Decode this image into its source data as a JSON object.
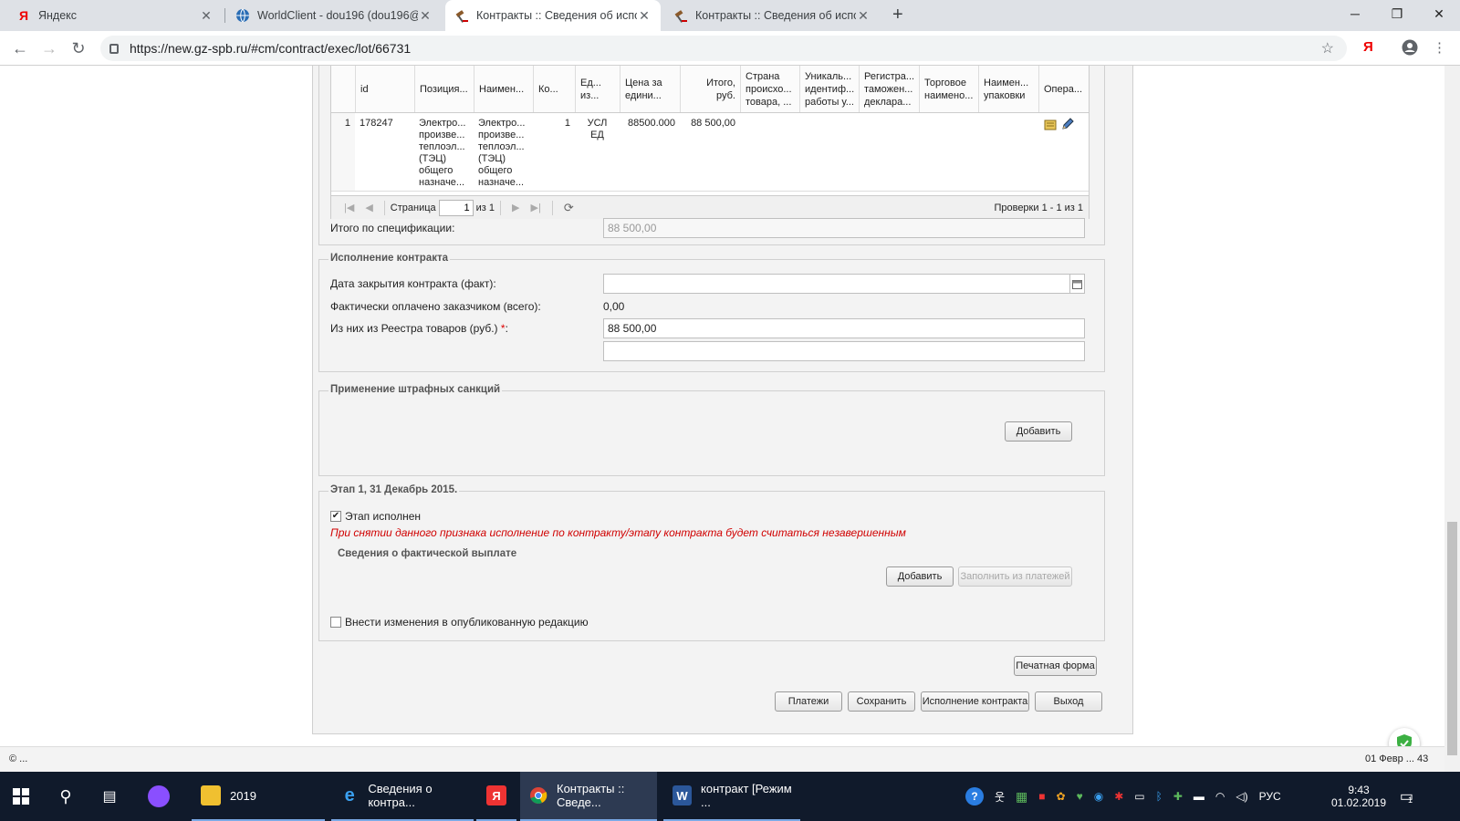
{
  "browser": {
    "tabs": [
      {
        "title": "Яндекс",
        "favicon": "Я"
      },
      {
        "title": "WorldClient - dou196 (dou196@",
        "favicon": "globe"
      },
      {
        "title": "Контракты :: Сведения об испол",
        "favicon": "gavel",
        "active": true
      },
      {
        "title": "Контракты :: Сведения об испол",
        "favicon": "gavel"
      }
    ],
    "url": "https://new.gz-spb.ru/#cm/contract/exec/lot/66731",
    "extension_label": "Я"
  },
  "grid": {
    "columns": [
      "",
      "id",
      "Позиция...",
      "Наимен...",
      "Ко...",
      "Ед... из...",
      "Цена за едини...",
      "Итого, руб.",
      "Страна происхо... товара, ...",
      "Уникаль... идентиф... работы у...",
      "Регистра... таможен... деклара...",
      "Торговое наимено...",
      "Наимен... упаковки",
      "Опера..."
    ],
    "row": {
      "num": "1",
      "id": "178247",
      "position": "Электро... произве... теплоэл... (ТЭЦ) общего назначе...",
      "name": "Электро... произве... теплоэл... (ТЭЦ) общего назначе...",
      "qty": "1",
      "unit": "УСЛ ЕД",
      "price": "88500.000",
      "total": "88 500,00"
    },
    "pager": {
      "page_label": "Страница",
      "page_value": "1",
      "of_label": "из 1",
      "summary": "Проверки 1 - 1 из 1"
    }
  },
  "spec_total": {
    "label": "Итого по спецификации:",
    "value": "88 500,00"
  },
  "execution": {
    "legend": "Исполнение контракта",
    "close_date_label": "Дата закрытия контракта (факт):",
    "close_date_value": "",
    "paid_label": "Фактически оплачено заказчиком (всего):",
    "paid_value": "0,00",
    "registry_label": "Из них из Реестра товаров (руб.)",
    "registry_required": "*",
    "registry_colon": ":",
    "registry_value": "88 500,00",
    "extra_value": ""
  },
  "penalties": {
    "legend": "Применение штрафных санкций",
    "add_label": "Добавить"
  },
  "stage": {
    "legend": "Этап 1, 31 Декабрь 2015.",
    "done_label": "Этап исполнен",
    "done_checked": true,
    "warning": "При снятии данного признака исполнение по контракту/этапу контракта будет считаться незавершенным",
    "payment_legend": "Сведения о фактической выплате",
    "add_label": "Добавить",
    "fill_label": "Заполнить из платежей",
    "edit_label": "Внести изменения в опубликованную редакцию"
  },
  "print_label": "Печатная форма",
  "footer_buttons": {
    "payments": "Платежи",
    "save": "Сохранить",
    "execution": "Исполнение контракта",
    "exit": "Выход"
  },
  "status": {
    "left": "© ...",
    "right": "01 Февр ... 43"
  },
  "taskbar": {
    "items": [
      {
        "label": "2019"
      },
      {
        "label": "Сведения о контра..."
      },
      {
        "label": ""
      },
      {
        "label": "Контракты :: Сведе..."
      },
      {
        "label": "контракт [Режим ..."
      }
    ],
    "lang": "РУС",
    "time": "9:43",
    "date": "01.02.2019",
    "notif_count": "1"
  },
  "colors": {
    "warning": "#d00000",
    "taskbar": "#101a2b"
  }
}
